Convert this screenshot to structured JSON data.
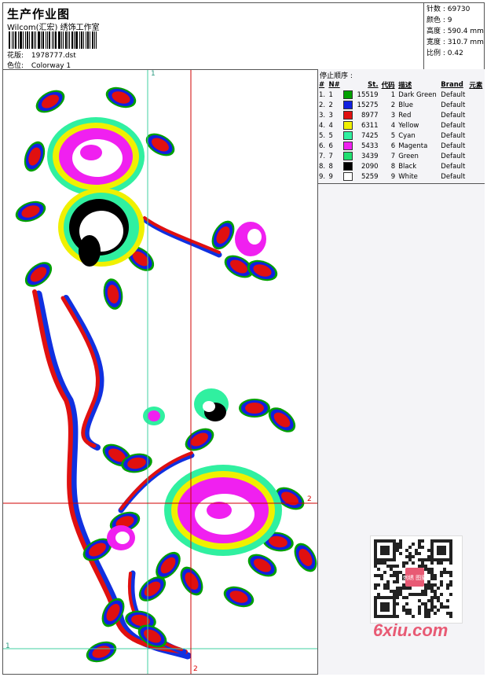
{
  "header": {
    "title": "生产作业图",
    "studio": "Wilcom(汇宏) 绣饰工作室",
    "design_label": "花版:",
    "design_value": "1978777.dst",
    "colorway_label": "色位:",
    "colorway_value": "Colorway 1"
  },
  "stats": {
    "stitches": "针数 : 69730",
    "colors": "颜色 : 9",
    "height": "高度 : 590.4 mm",
    "width": "宽度 : 310.7 mm",
    "scale": "比例 : 0.42"
  },
  "stop_sequence": {
    "title": "停止顺序 :",
    "headers": [
      "#",
      "N#",
      "St.",
      "代码",
      "描述",
      "Brand",
      "元素"
    ],
    "rows": [
      {
        "idx": "1.",
        "n": "1",
        "color": "#00a000",
        "st": "15519",
        "code": "1",
        "desc": "Dark Green",
        "brand": "Default"
      },
      {
        "idx": "2.",
        "n": "2",
        "color": "#1020e0",
        "st": "15275",
        "code": "2",
        "desc": "Blue",
        "brand": "Default"
      },
      {
        "idx": "3.",
        "n": "3",
        "color": "#e01010",
        "st": "8977",
        "code": "3",
        "desc": "Red",
        "brand": "Default"
      },
      {
        "idx": "4.",
        "n": "4",
        "color": "#f0f000",
        "st": "6311",
        "code": "4",
        "desc": "Yellow",
        "brand": "Default"
      },
      {
        "idx": "5.",
        "n": "5",
        "color": "#30f0a0",
        "st": "7425",
        "code": "5",
        "desc": "Cyan",
        "brand": "Default"
      },
      {
        "idx": "6.",
        "n": "6",
        "color": "#f020f0",
        "st": "5433",
        "code": "6",
        "desc": "Magenta",
        "brand": "Default"
      },
      {
        "idx": "7.",
        "n": "7",
        "color": "#20e070",
        "st": "3439",
        "code": "7",
        "desc": "Green",
        "brand": "Default"
      },
      {
        "idx": "8.",
        "n": "8",
        "color": "#000000",
        "st": "2090",
        "code": "8",
        "desc": "Black",
        "brand": "Default"
      },
      {
        "idx": "9.",
        "n": "9",
        "color": "#ffffff",
        "st": "5259",
        "code": "9",
        "desc": "White",
        "brand": "Default"
      }
    ]
  },
  "guides": {
    "v1_label": "1",
    "h1_label": "1",
    "v2_label": "2",
    "h2_label": "2"
  },
  "watermark": {
    "text": "6xiu.com",
    "qr_stamp": "刺绣 图案"
  },
  "colors": {
    "guide_green": "#40d0a0",
    "guide_red": "#d00000",
    "accent_logo": "#e85a74"
  }
}
